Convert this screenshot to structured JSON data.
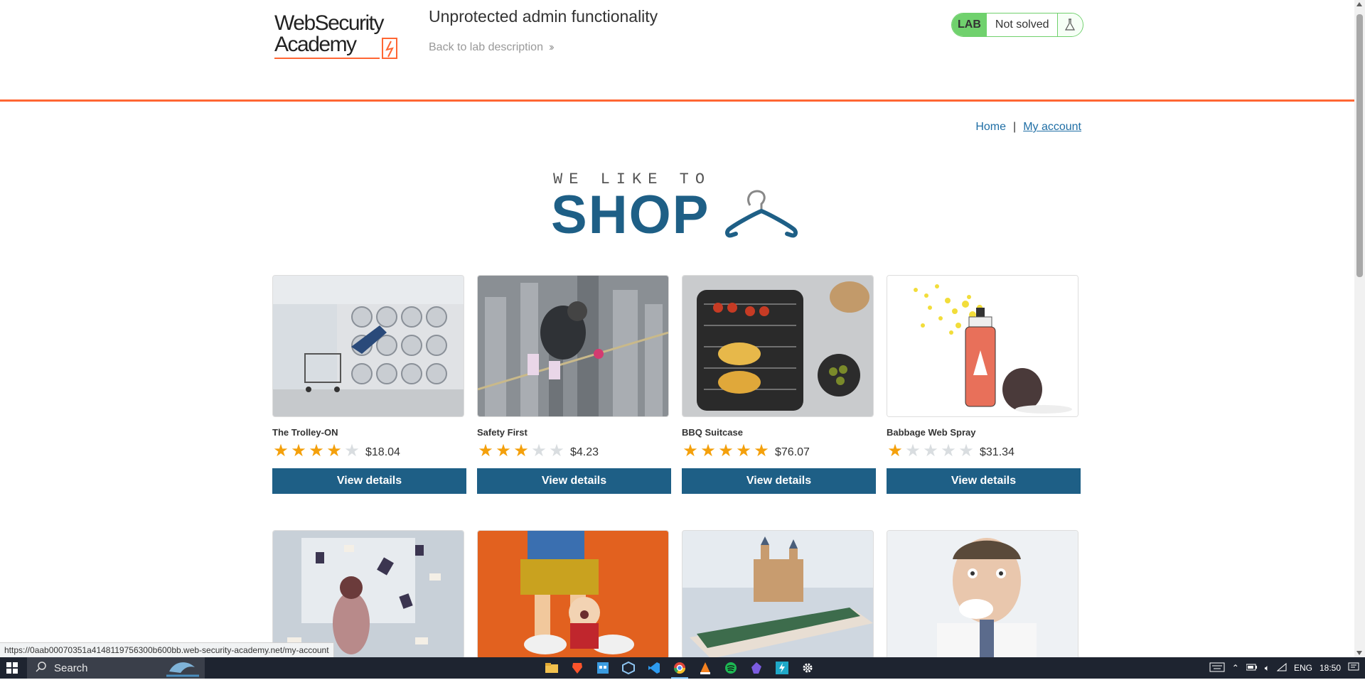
{
  "header": {
    "logo_line1": "WebSecurity",
    "logo_line2": "Academy",
    "lab_title": "Unprotected admin functionality",
    "back_link": "Back to lab description",
    "lab_badge": "LAB",
    "status": "Not solved",
    "accent_color": "#ff6633",
    "solved_color": "#70d16d"
  },
  "nav": {
    "home": "Home",
    "separator": "|",
    "my_account": "My account"
  },
  "banner": {
    "top_text": "WE LIKE TO",
    "main_text": "SHOP"
  },
  "products": [
    {
      "name": "The Trolley-ON",
      "rating": 4,
      "price": "$18.04",
      "button": "View details"
    },
    {
      "name": "Safety First",
      "rating": 3,
      "price": "$4.23",
      "button": "View details"
    },
    {
      "name": "BBQ Suitcase",
      "rating": 5,
      "price": "$76.07",
      "button": "View details"
    },
    {
      "name": "Babbage Web Spray",
      "rating": 1,
      "price": "$31.34",
      "button": "View details"
    }
  ],
  "status_url": "https://0aab00070351a4148119756300b600bb.web-security-academy.net/my-account",
  "taskbar": {
    "search_label": "Search",
    "language": "ENG",
    "time": "18:50"
  },
  "button_color": "#1e5f86"
}
